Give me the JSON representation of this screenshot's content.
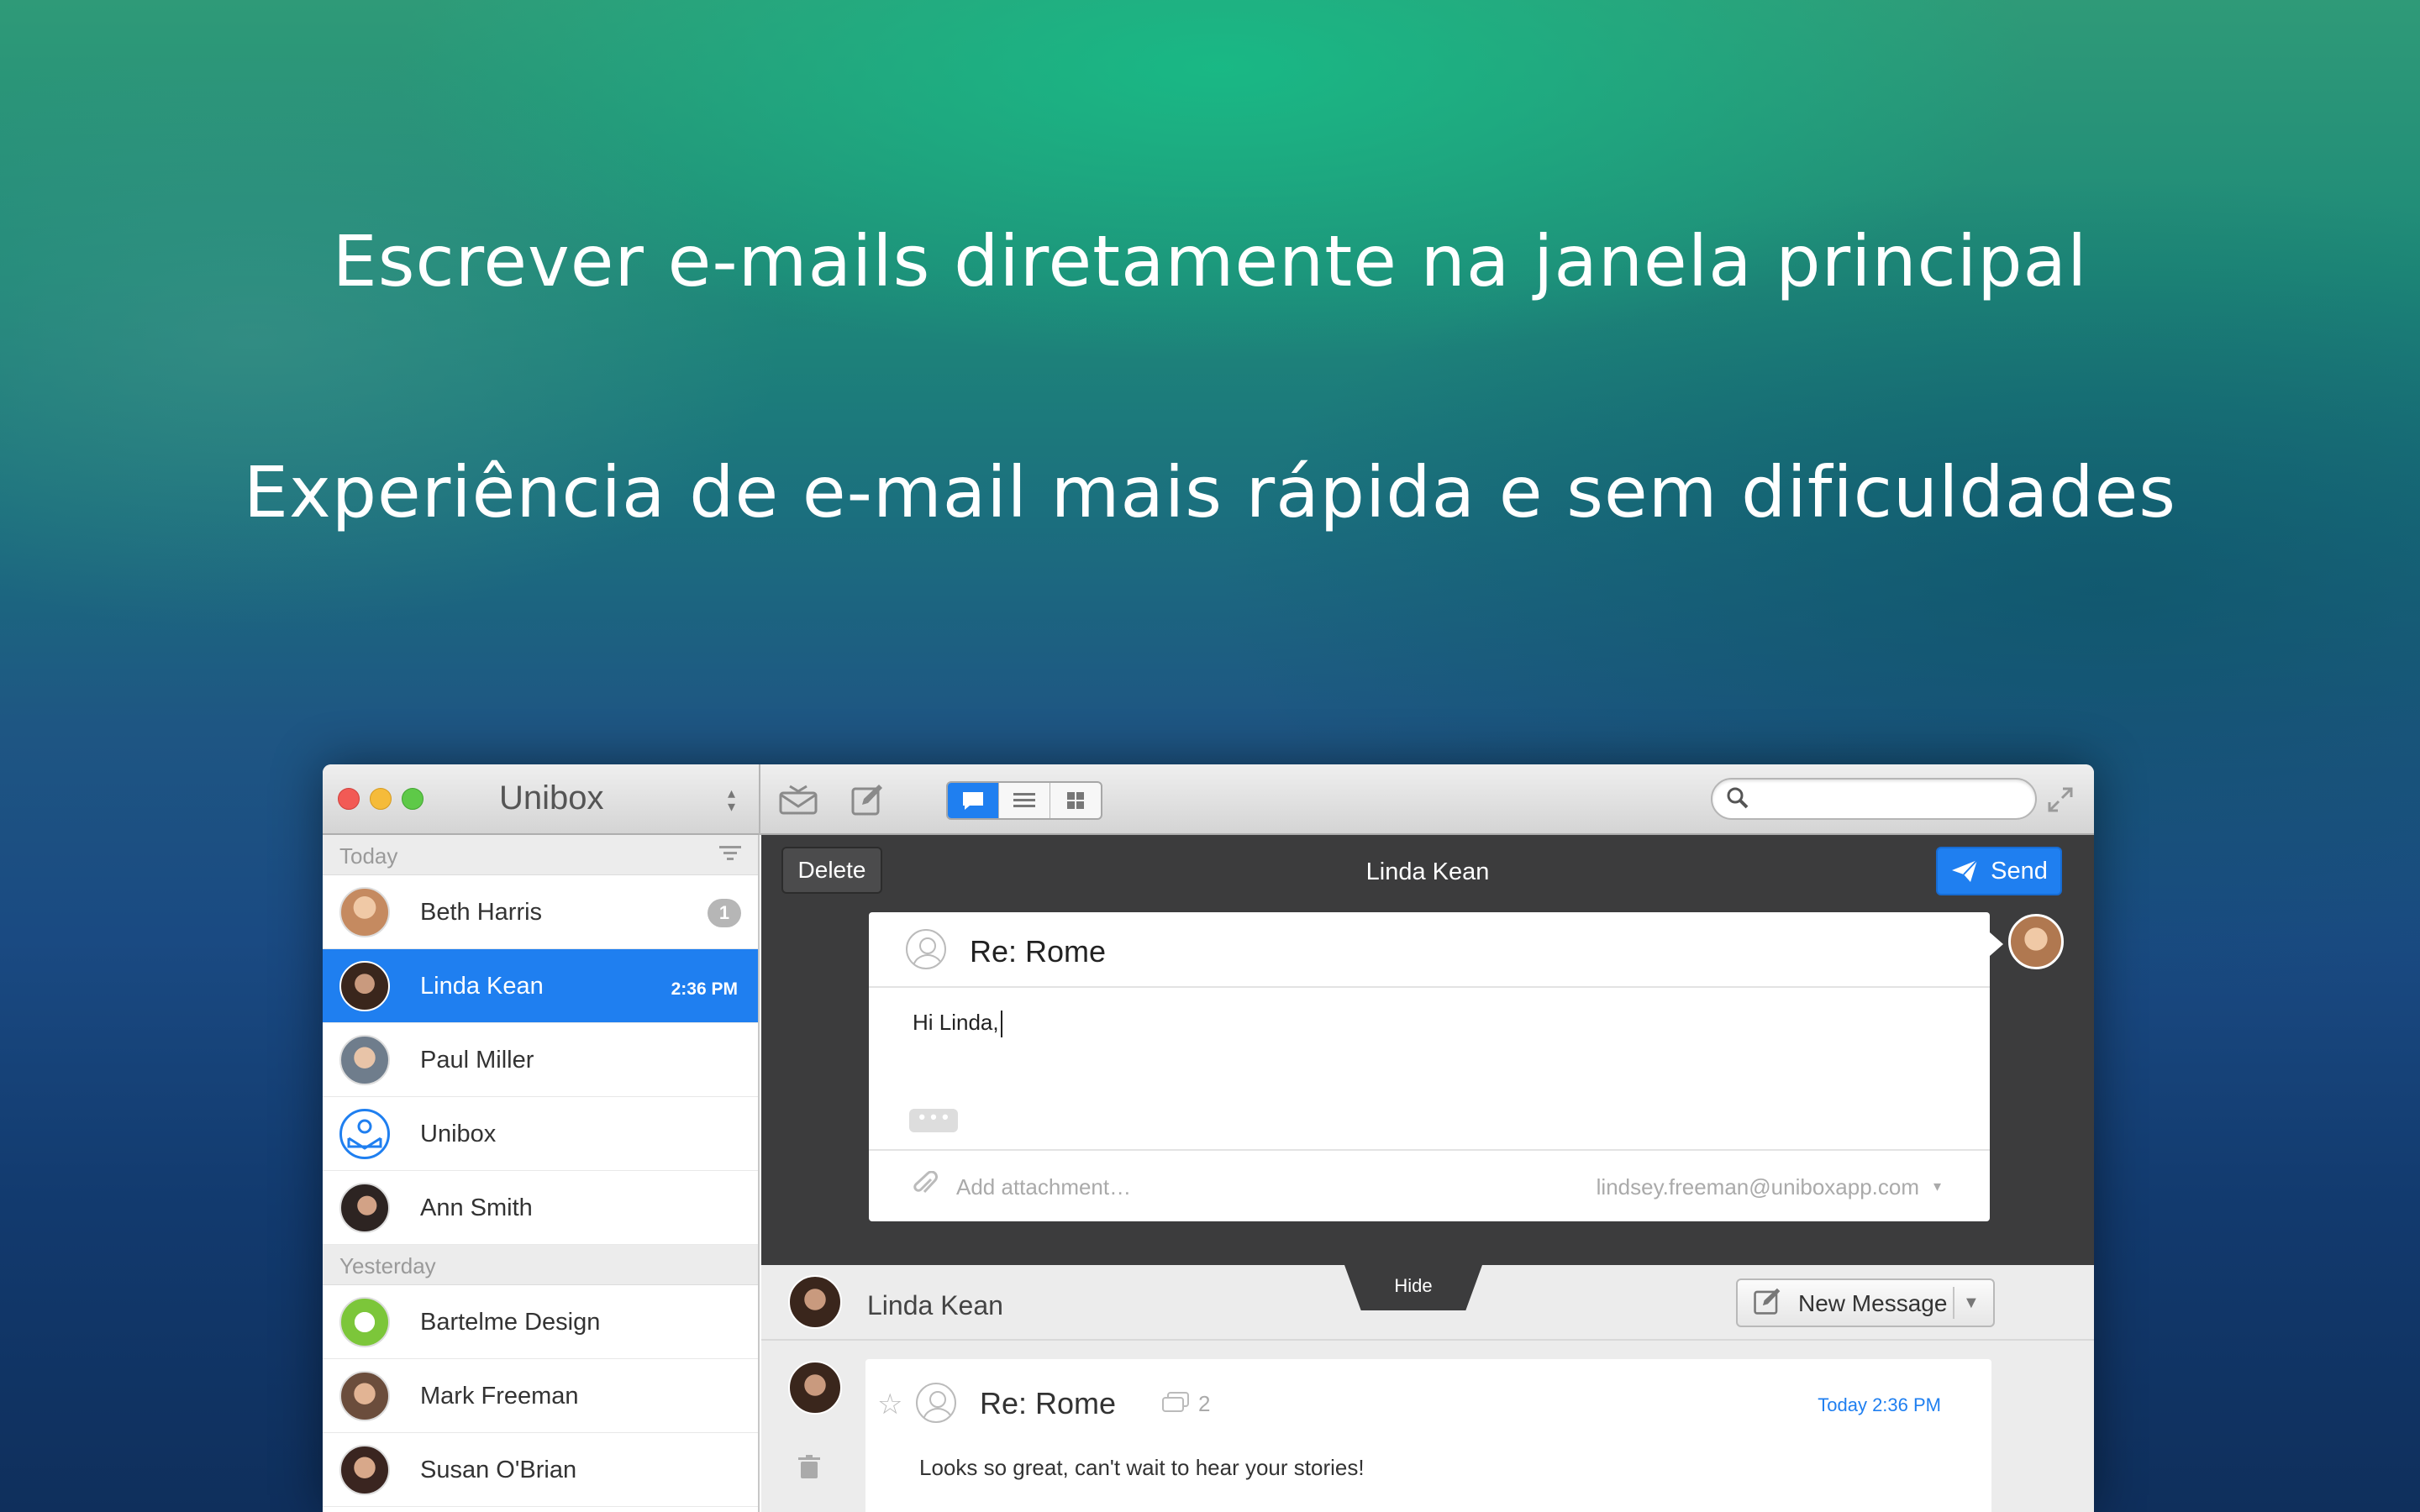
{
  "headline": {
    "line1": "Escrever e-mails diretamente na janela principal",
    "line2": "Experiência de e-mail mais rápida e sem dificuldades"
  },
  "app": {
    "title": "Unibox"
  },
  "icons": {
    "archive": "archive-icon",
    "compose": "compose-icon",
    "search": "search-icon",
    "fullscreen": "fullscreen-icon",
    "send": "paper-plane-icon",
    "attachment": "paperclip-icon"
  },
  "colors": {
    "accent": "#1f7ff0",
    "dark_panel": "#3c3c3d"
  },
  "sidebar": {
    "sections": [
      {
        "label": "Today",
        "items": [
          {
            "name": "Beth Harris",
            "badge": "1",
            "avatar_color": "#c58a60"
          },
          {
            "name": "Linda Kean",
            "time": "2:36 PM",
            "selected": true,
            "avatar_color": "#5a3b2c"
          },
          {
            "name": "Paul Miller",
            "avatar_color": "#9a8a7a"
          },
          {
            "name": "Unibox",
            "avatar_color": "#1f7ff0"
          },
          {
            "name": "Ann Smith",
            "avatar_color": "#3e3532"
          }
        ]
      },
      {
        "label": "Yesterday",
        "items": [
          {
            "name": "Bartelme Design",
            "avatar_color": "#7cc63a"
          },
          {
            "name": "Mark Freeman",
            "avatar_color": "#8a6c58"
          },
          {
            "name": "Susan O'Brian",
            "avatar_color": "#4a3228"
          }
        ]
      }
    ]
  },
  "compose": {
    "delete_label": "Delete",
    "title": "Linda Kean",
    "send_label": "Send",
    "subject": "Re: Rome",
    "body": "Hi Linda,",
    "more": "• • •",
    "attach_placeholder": "Add attachment…",
    "from": "lindsey.freeman@uniboxapp.com"
  },
  "conversation": {
    "hide_label": "Hide",
    "contact": "Linda Kean",
    "new_message_label": "New Message",
    "message": {
      "subject": "Re: Rome",
      "thread_count": "2",
      "date": "Today 2:36 PM",
      "text": "Looks so great, can't wait to hear your stories!"
    }
  }
}
